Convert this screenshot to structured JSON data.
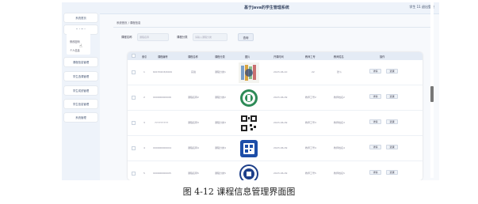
{
  "app": {
    "title": "基于Java的学生管理系统",
    "user": "学生 11  退出登录"
  },
  "sidebar": {
    "items": [
      {
        "label": "系统首页"
      },
      {
        "label": "个人中心"
      },
      {
        "label": "课程信息管理"
      },
      {
        "label": "学生选课管理"
      },
      {
        "label": "学生成绩管理"
      },
      {
        "label": "学生信息管理"
      },
      {
        "label": "系统管理"
      }
    ],
    "submenu": [
      "修改密码",
      "个人信息"
    ]
  },
  "breadcrumb": {
    "home": "系统首页",
    "current": "课程信息"
  },
  "search": {
    "course_no_label": "课程名称",
    "course_no_placeholder": "课程名称",
    "course_name_label": "课程分类",
    "course_name_placeholder": "请输入课程分类",
    "button": "查询"
  },
  "table": {
    "headers": [
      "索引",
      "课程编号",
      "课程名称",
      "课程分类",
      "图片",
      "开课时间",
      "教师工号",
      "教师姓名",
      "操作"
    ],
    "rows": [
      {
        "idx": "1",
        "no": "60153203/0009",
        "name": "实验",
        "category": "课程分类1",
        "date": "2023-06-10",
        "teacher_no": "22",
        "teacher_name": "张斗"
      },
      {
        "idx": "2",
        "no": "000000000006",
        "name": "课程名称2",
        "category": "课程分类2",
        "date": "2023-06-09",
        "teacher_no": "教师工号2",
        "teacher_name": "教师姓名2"
      },
      {
        "idx": "3",
        "no": "777777777",
        "name": "课程名称3",
        "category": "课程分类3",
        "date": "2023-06-09",
        "teacher_no": "教师工号3",
        "teacher_name": "教师姓名3"
      },
      {
        "idx": "4",
        "no": "000000000004",
        "name": "课程名称4",
        "category": "课程分类4",
        "date": "2023-06-09",
        "teacher_no": "教师工号4",
        "teacher_name": "教师姓名4"
      },
      {
        "idx": "5",
        "no": "000000000005",
        "name": "课程名称5",
        "category": "课程分类5",
        "date": "2023-06-09",
        "teacher_no": "教师工号5",
        "teacher_name": "教师姓名5"
      }
    ],
    "detail_label": "详情",
    "select_label": "选课"
  },
  "caption": "图 4-12 课程信息管理界面图"
}
